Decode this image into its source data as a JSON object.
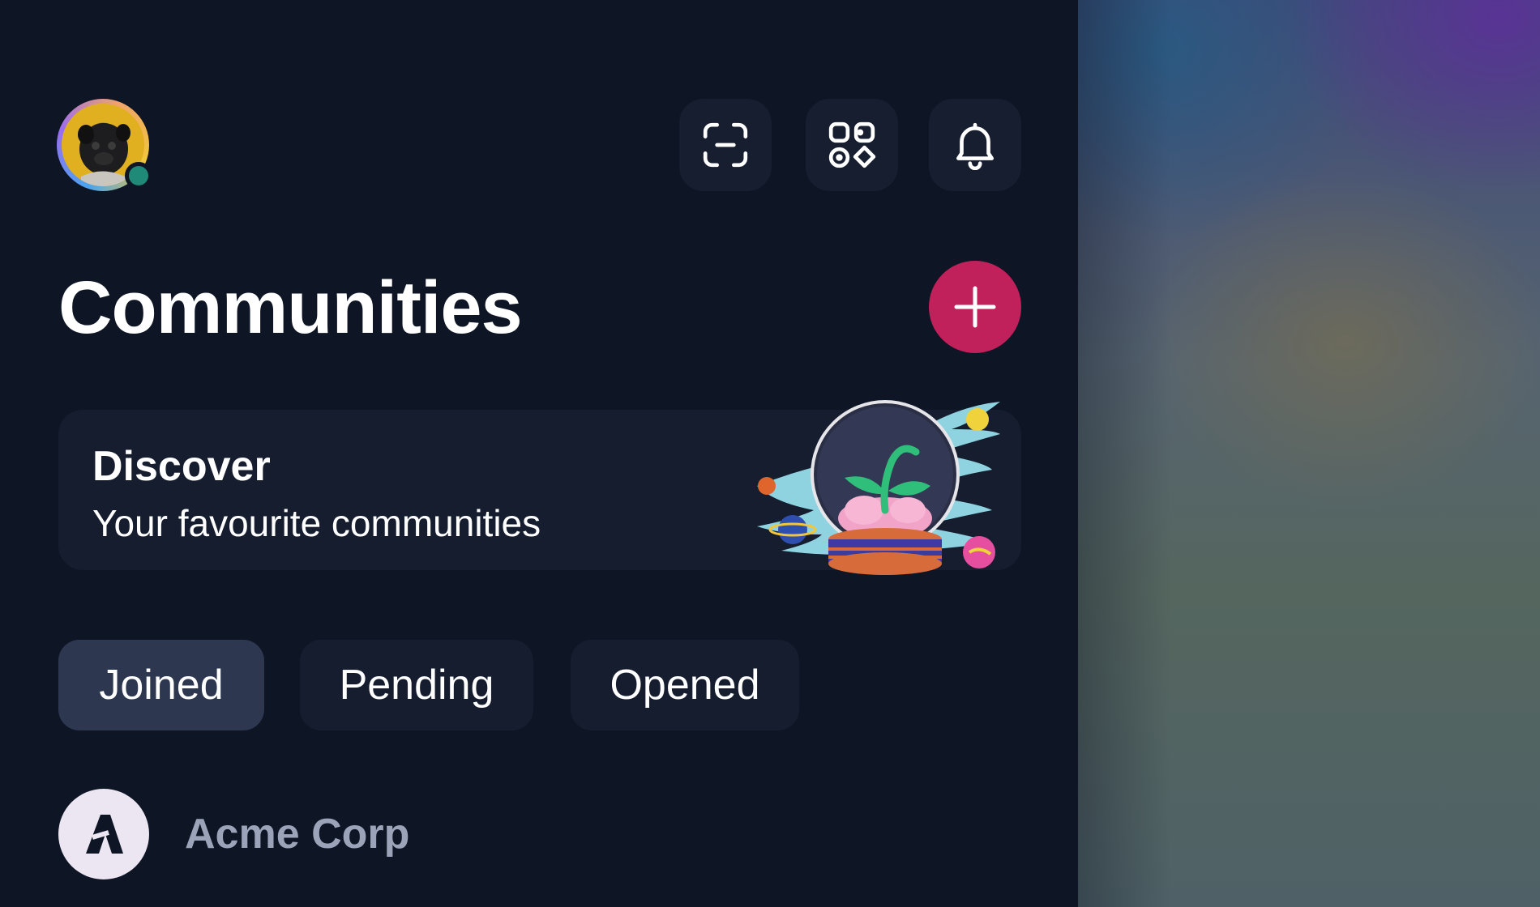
{
  "header": {
    "avatar_icon": "pug-avatar",
    "status": "online",
    "buttons": [
      {
        "icon": "scan-icon"
      },
      {
        "icon": "apps-icon"
      },
      {
        "icon": "bell-icon"
      }
    ]
  },
  "page": {
    "title": "Communities",
    "add_icon": "plus-icon"
  },
  "discover": {
    "title": "Discover",
    "subtitle": "Your favourite communities",
    "illustration": "snow-globe-plant-illustration"
  },
  "tabs": [
    {
      "label": "Joined",
      "active": true
    },
    {
      "label": "Pending",
      "active": false
    },
    {
      "label": "Opened",
      "active": false
    }
  ],
  "communities": [
    {
      "name": "Acme Corp",
      "logo": "acme-logo-icon"
    }
  ],
  "colors": {
    "background": "#0e1525",
    "card": "#151d2f",
    "active_tab": "#2d3850",
    "accent": "#c0215a",
    "status": "#1f8a78"
  }
}
